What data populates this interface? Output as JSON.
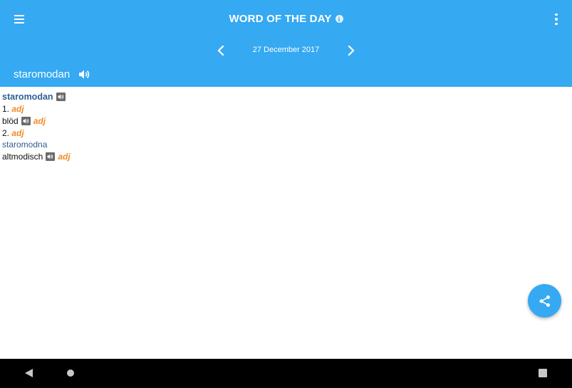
{
  "appbar": {
    "title": "WORD OF THE DAY",
    "info_icon": "info-icon",
    "menu_icon": "hamburger-menu-icon",
    "overflow_icon": "more-vert-icon",
    "date": "27 December 2017",
    "prev_icon": "chevron-left-icon",
    "next_icon": "chevron-right-icon",
    "word": "staromodan",
    "speaker_icon": "speaker-icon",
    "color": "#35a9f2"
  },
  "entry": {
    "headword": "staromodan",
    "senses": [
      {
        "number": "1.",
        "pos": "adj",
        "translation": "blöd",
        "translation_pos": "adj"
      },
      {
        "number": "2.",
        "pos": "adj",
        "alt_form": "staromodna",
        "translation": "altmodisch",
        "translation_pos": "adj"
      }
    ],
    "colors": {
      "headword": "#2d5f94",
      "pos": "#f08a24"
    }
  },
  "fab": {
    "icon": "share-icon"
  },
  "system_nav": {
    "back_icon": "back-triangle-icon",
    "home_icon": "home-circle-icon",
    "recents_icon": "recents-square-icon"
  }
}
